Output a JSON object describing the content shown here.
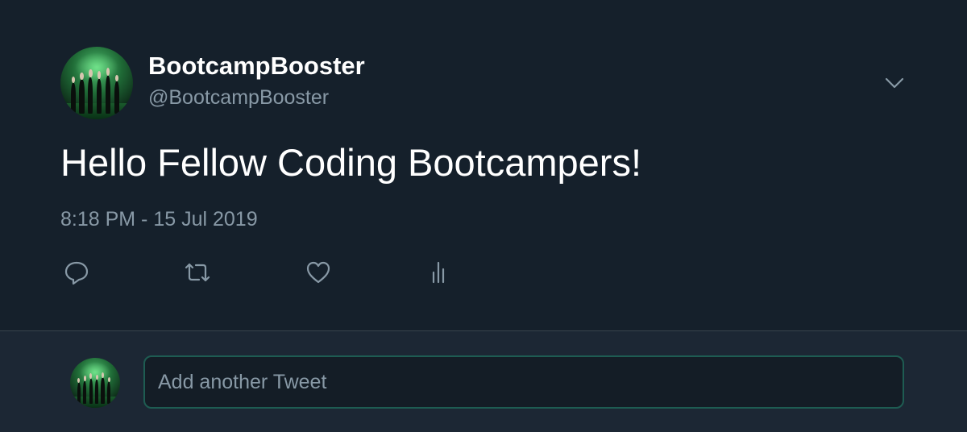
{
  "tweet": {
    "display_name": "BootcampBooster",
    "handle": "@BootcampBooster",
    "text": "Hello Fellow Coding Bootcampers!",
    "timestamp": "8:18 PM - 15 Jul 2019",
    "menu_icon": "chevron-down-icon",
    "actions": {
      "reply_icon": "reply-icon",
      "retweet_icon": "retweet-icon",
      "like_icon": "heart-icon",
      "analytics_icon": "analytics-icon"
    }
  },
  "composer": {
    "placeholder": "Add another Tweet"
  },
  "colors": {
    "background": "#15202b",
    "reply_area_background": "#1c2734",
    "secondary_text": "#8899a6",
    "divider": "#38444d",
    "composer_border": "#1e5c52"
  }
}
